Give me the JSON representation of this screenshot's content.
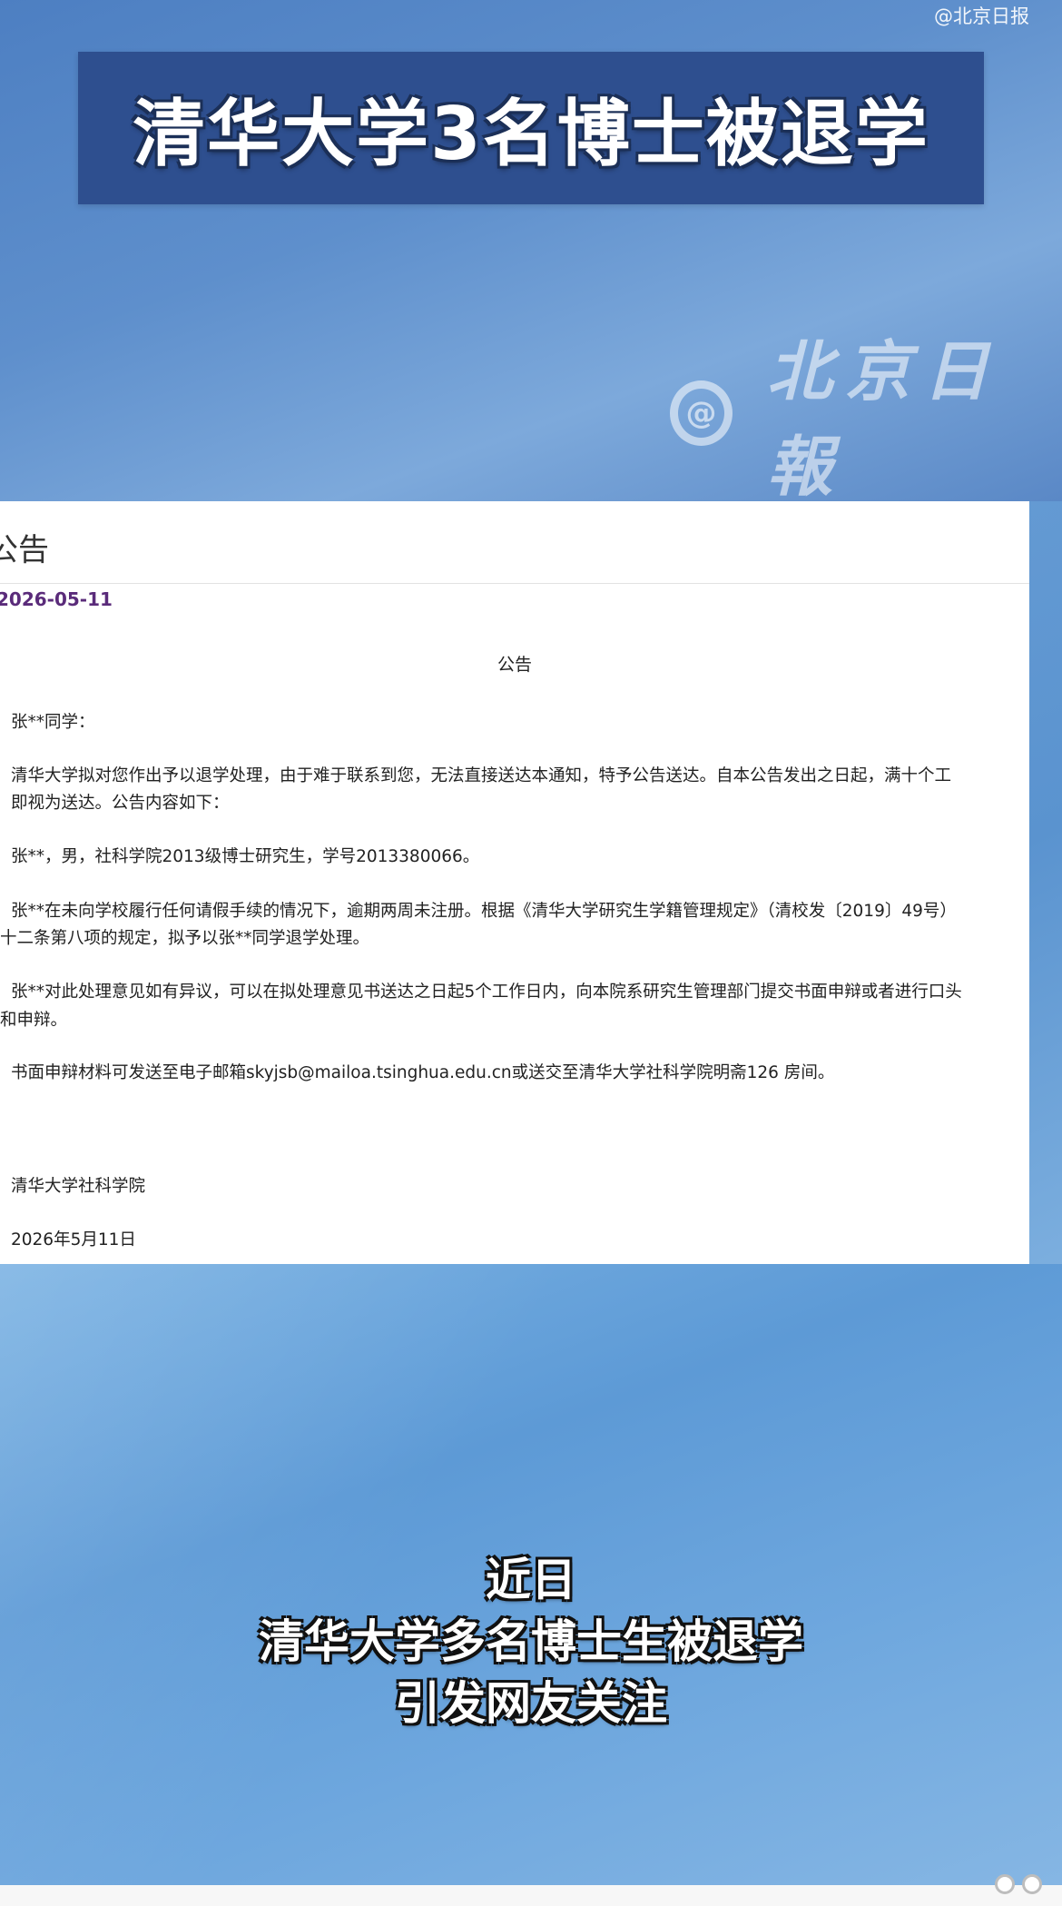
{
  "handle": "@北京日报",
  "title": "清华大学3名博士被退学",
  "watermark": {
    "logo": "@",
    "text": "北京日報"
  },
  "doc": {
    "header_title": "公告",
    "date": "2026-05-11",
    "heading": "公告",
    "paragraphs": [
      "张**同学：",
      "清华大学拟对您作出予以退学处理，由于难于联系到您，无法直接送达本通知，特予公告送达。自本公告发出之日起，满十个工",
      "即视为送达。公告内容如下：",
      "张**，男，社科学院2013级博士研究生，学号2013380066。",
      "张**在未向学校履行任何请假手续的情况下，逾期两周未注册。根据《清华大学研究生学籍管理规定》（清校发〔2019〕49号）",
      "十二条第八项的规定，拟予以张**同学退学处理。",
      "张**对此处理意见如有异议，可以在拟处理意见书送达之日起5个工作日内，向本院系研究生管理部门提交书面申辩或者进行口头",
      "和申辩。",
      "书面申辩材料可发送至电子邮箱skyjsb@mailoa.tsinghua.edu.cn或送交至清华大学社科学院明斋126 房间。",
      "清华大学社科学院",
      "2026年5月11日"
    ]
  },
  "subtitle_lines": [
    "近日",
    "清华大学多名博士生被退学",
    "引发网友关注"
  ]
}
